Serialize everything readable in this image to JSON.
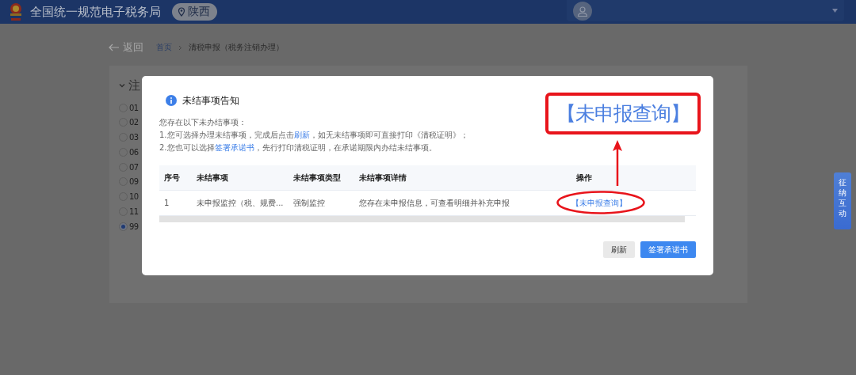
{
  "header": {
    "title": "全国统一规范电子税务局",
    "region": "陕西"
  },
  "breadcrumb": {
    "back": "返回",
    "items": [
      {
        "label": "首页",
        "kind": "link"
      },
      {
        "label": "清税申报（税务注销办理）",
        "kind": "current"
      }
    ]
  },
  "card": {
    "title": "注",
    "expanded": true,
    "options": [
      {
        "label": "01",
        "selected": false
      },
      {
        "label": "02",
        "selected": false
      },
      {
        "label": "03",
        "selected": false
      },
      {
        "label": "06",
        "selected": false
      },
      {
        "label": "07",
        "selected": false
      },
      {
        "label": "09",
        "selected": false
      },
      {
        "label": "10",
        "selected": false
      },
      {
        "label": "11",
        "selected": false
      },
      {
        "label": "99",
        "selected": true
      }
    ]
  },
  "side_tab": {
    "label": "征纳互动"
  },
  "dialog": {
    "title": "未结事项告知",
    "lines": [
      [
        {
          "kind": "text",
          "text": "您存在以下未办结事项："
        }
      ],
      [
        {
          "kind": "text",
          "text": "1.您可选择办理未结事项，完成后点击"
        },
        {
          "kind": "link",
          "text": "刷新"
        },
        {
          "kind": "text",
          "text": "，如无未结事项即可直接打印《清税证明》；"
        }
      ],
      [
        {
          "kind": "text",
          "text": "2.您也可以选择"
        },
        {
          "kind": "link",
          "text": "签署承诺书"
        },
        {
          "kind": "text",
          "text": "，先行打印清税证明，在承诺期限内办结未结事项。"
        }
      ]
    ],
    "table": {
      "columns": [
        "序号",
        "未结事项",
        "未结事项类型",
        "未结事项详情",
        "操作"
      ],
      "rows": [
        {
          "cells": [
            "1",
            "未申报监控（税、规费...",
            "强制监控",
            "您存在未申报信息，可查看明细并补充申报"
          ],
          "action": "【未申报查询】"
        }
      ]
    },
    "buttons": [
      {
        "label": "刷新",
        "kind": "secondary"
      },
      {
        "label": "签署承诺书",
        "kind": "primary"
      }
    ]
  },
  "annotation": {
    "callout": "【未申报查询】"
  }
}
